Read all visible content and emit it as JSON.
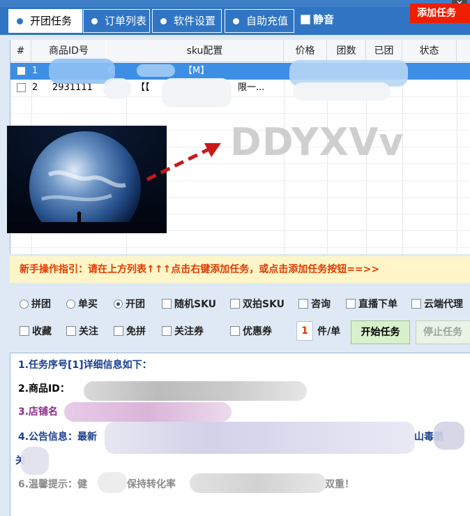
{
  "tabs": [
    {
      "label": "开团任务",
      "active": true
    },
    {
      "label": "订单列表",
      "active": false
    },
    {
      "label": "软件设置",
      "active": false
    },
    {
      "label": "自助充值",
      "active": false
    }
  ],
  "mute_label": "静音",
  "grid": {
    "columns": [
      "#",
      "商品ID号",
      "sku配置",
      "价格",
      "团数",
      "已团",
      "状态"
    ],
    "rows": [
      {
        "num": "1",
        "id": "6",
        "sku": "【M】",
        "selected": true
      },
      {
        "num": "2",
        "id": "2931111",
        "sku": "【【",
        "sku_tail": "限一...",
        "selected": false
      }
    ]
  },
  "watermark": "DDYXVv",
  "guide": {
    "text": "新手操作指引：请在上方列表↑↑↑点击右键添加任务，或点击添加任务按钮==>>",
    "add_button": "添加任务"
  },
  "options_row1": [
    {
      "type": "radio",
      "label": "拼团",
      "checked": false
    },
    {
      "type": "radio",
      "label": "单买",
      "checked": false
    },
    {
      "type": "radio",
      "label": "开团",
      "checked": true
    },
    {
      "type": "check",
      "label": "随机SKU",
      "checked": false
    },
    {
      "type": "check",
      "label": "双拍SKU",
      "checked": false
    },
    {
      "type": "check",
      "label": "咨询",
      "checked": false
    },
    {
      "type": "check",
      "label": "直播下单",
      "checked": false
    },
    {
      "type": "check",
      "label": "云端代理",
      "checked": false
    }
  ],
  "options_row2": [
    {
      "label": "收藏"
    },
    {
      "label": "关注"
    },
    {
      "label": "免拼"
    },
    {
      "label": "关注券"
    },
    {
      "label": "优惠券"
    }
  ],
  "quantity": "1",
  "quantity_unit": "件/单",
  "start_button": "开始任务",
  "stop_button": "停止任务",
  "info": {
    "line1": "1.任务序号[1]详细信息如下：",
    "line2": "2.商品ID：",
    "line3": "3.店铺名",
    "line4a": "4.公告信息：最新",
    "line4b": "山毒霸",
    "line5": "关",
    "line6a": "6.温馨提示：健",
    "line6b": "保持转化率",
    "line6c": "双重！",
    "colors": {
      "blue": "#1a3f8f",
      "purple": "#8a2c8a",
      "gray": "#8a8a8a"
    }
  }
}
